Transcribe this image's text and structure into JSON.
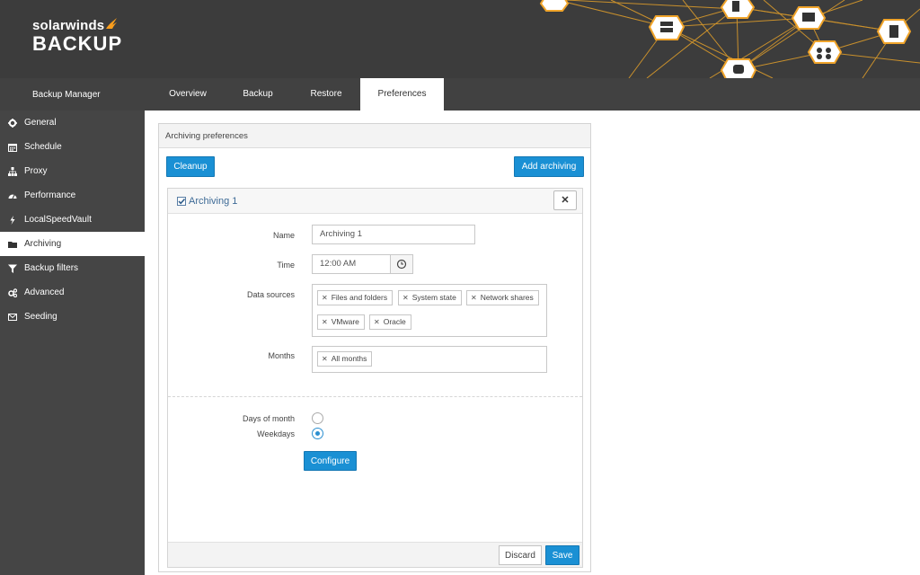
{
  "brand": {
    "top": "solarwinds",
    "bottom": "BACKUP",
    "accent": "#f99d1c"
  },
  "topnav": {
    "app_title": "Backup Manager",
    "tabs": [
      {
        "label": "Overview"
      },
      {
        "label": "Backup"
      },
      {
        "label": "Restore"
      },
      {
        "label": "Preferences",
        "active": true
      }
    ]
  },
  "sidebar": {
    "items": [
      {
        "label": "General",
        "icon": "gear-icon"
      },
      {
        "label": "Schedule",
        "icon": "calendar-icon"
      },
      {
        "label": "Proxy",
        "icon": "network-icon"
      },
      {
        "label": "Performance",
        "icon": "gauge-icon"
      },
      {
        "label": "LocalSpeedVault",
        "icon": "bolt-icon"
      },
      {
        "label": "Archiving",
        "icon": "folder-icon",
        "active": true
      },
      {
        "label": "Backup filters",
        "icon": "filter-icon"
      },
      {
        "label": "Advanced",
        "icon": "gears-icon"
      },
      {
        "label": "Seeding",
        "icon": "envelope-icon"
      }
    ]
  },
  "panel": {
    "title": "Archiving preferences",
    "cleanup_label": "Cleanup",
    "add_label": "Add archiving",
    "card": {
      "title": "Archiving 1",
      "checked": true,
      "close_label": "✕",
      "name_label": "Name",
      "name_value": "Archiving 1",
      "time_label": "Time",
      "time_value": "12:00 AM",
      "data_sources_label": "Data sources",
      "data_sources": [
        "Files and folders",
        "System state",
        "Network shares",
        "VMware",
        "Oracle"
      ],
      "months_label": "Months",
      "months": [
        "All months"
      ],
      "days_of_month_label": "Days of month",
      "weekdays_label": "Weekdays",
      "selected_option": "Weekdays",
      "configure_label": "Configure",
      "discard_label": "Discard",
      "save_label": "Save"
    }
  },
  "colors": {
    "primary_button": "#1a90d4",
    "sidebar_bg": "#454545",
    "header_bg": "#3c3c3c"
  }
}
